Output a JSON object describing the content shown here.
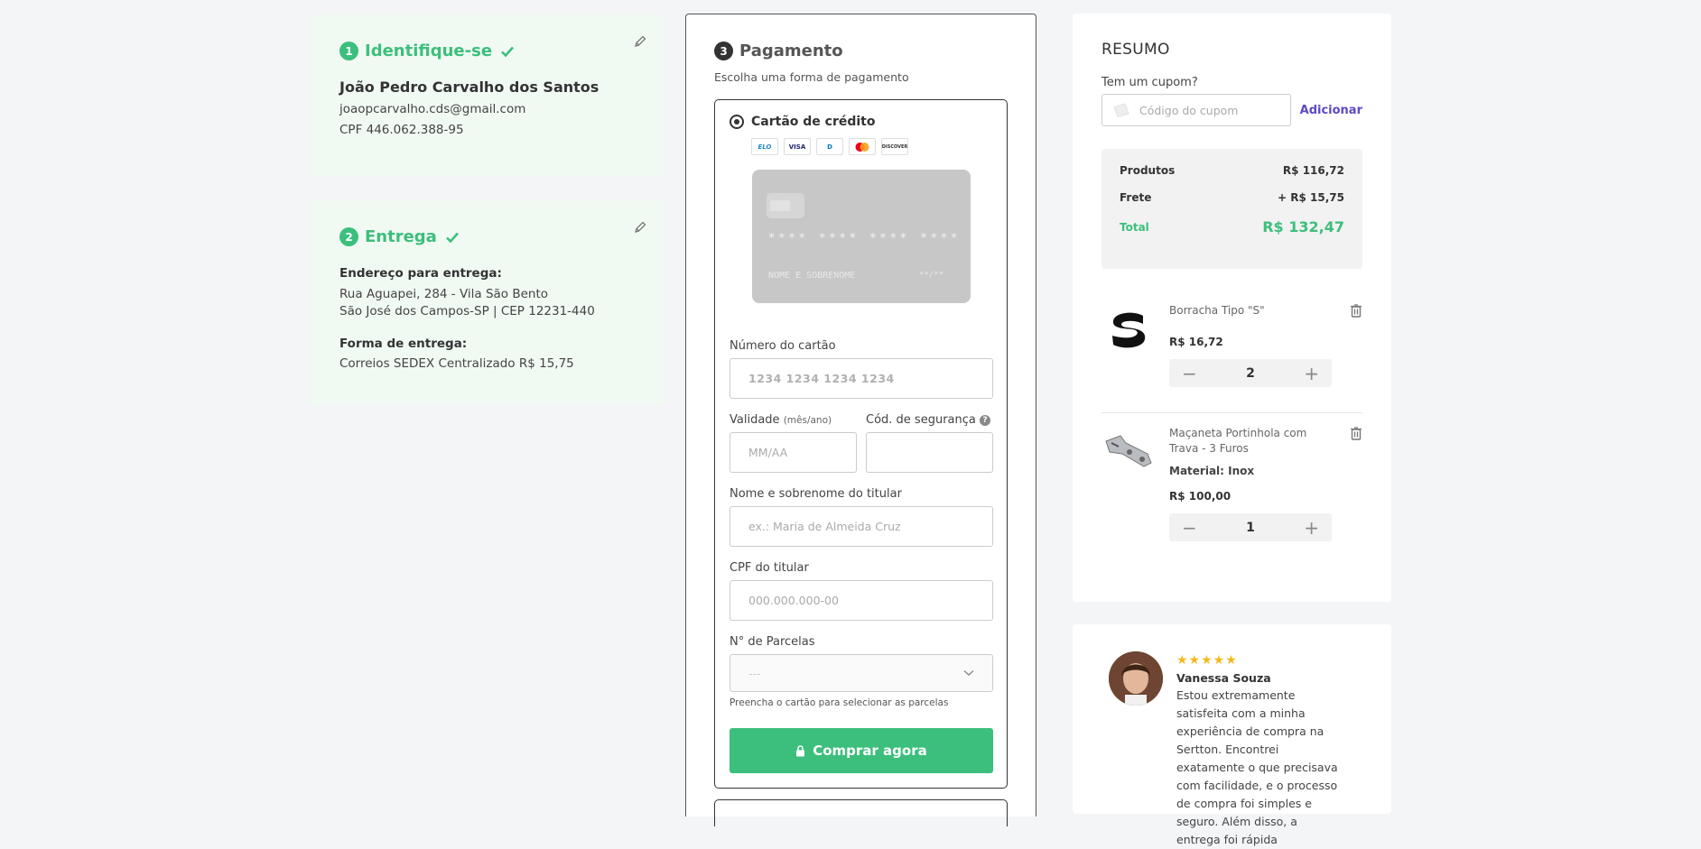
{
  "step1": {
    "number": "1",
    "title": "Identifique-se",
    "name": "João Pedro Carvalho dos Santos",
    "email": "joaopcarvalho.cds@gmail.com",
    "cpf": "CPF 446.062.388-95"
  },
  "step2": {
    "number": "2",
    "title": "Entrega",
    "address_label": "Endereço para entrega:",
    "address_line1": "Rua Aguapei, 284 - Vila São Bento",
    "address_line2": "São José dos Campos-SP | CEP 12231-440",
    "shipping_label": "Forma de entrega:",
    "shipping_value": "Correios SEDEX Centralizado R$ 15,75"
  },
  "payment": {
    "number": "3",
    "title": "Pagamento",
    "subtitle": "Escolha uma forma de pagamento",
    "method": "Cartão de crédito",
    "brands": [
      "ELO",
      "VISA",
      "D",
      "MC",
      "DISCOVER"
    ],
    "card_preview": {
      "number": "**** **** **** ****",
      "name": "NOME E SOBRENOME",
      "expiry": "**/**"
    },
    "fields": {
      "card_number_label": "Número do cartão",
      "card_number_placeholder": "1234 1234 1234 1234",
      "validity_label": "Validade",
      "validity_hint": "(mês/ano)",
      "validity_placeholder": "MM/AA",
      "cvv_label": "Cód. de segurança",
      "holder_label": "Nome e sobrenome do titular",
      "holder_placeholder": "ex.: Maria de Almeida Cruz",
      "cpf_label": "CPF do titular",
      "cpf_placeholder": "000.000.000-00",
      "installments_label": "N° de Parcelas",
      "installments_value": "---",
      "installments_hint": "Preencha o cartão para selecionar as parcelas"
    },
    "buy_button": "Comprar agora"
  },
  "summary": {
    "title": "RESUMO",
    "coupon_label": "Tem um cupom?",
    "coupon_placeholder": "Código do cupom",
    "coupon_add": "Adicionar",
    "products_label": "Produtos",
    "products_value": "R$ 116,72",
    "shipping_label": "Frete",
    "shipping_value": "+ R$ 15,75",
    "total_label": "Total",
    "total_value": "R$ 132,47",
    "items": [
      {
        "name": "Borracha Tipo \"S\"",
        "variant": "",
        "price": "R$ 16,72",
        "qty": "2"
      },
      {
        "name": "Maçaneta Portinhola com Trava - 3 Furos",
        "variant": "Material: Inox",
        "price": "R$ 100,00",
        "qty": "1"
      }
    ]
  },
  "review": {
    "stars": "★★★★★",
    "name": "Vanessa Souza",
    "text": "Estou extremamente satisfeita com a minha experiência de compra na Sertton. Encontrei exatamente o que precisava com facilidade, e o processo de compra foi simples e seguro. Além disso, a entrega foi rápida"
  },
  "colors": {
    "accent_green": "#3cbf7c",
    "link_purple": "#5c49c7",
    "star_yellow": "#f5b91d"
  }
}
